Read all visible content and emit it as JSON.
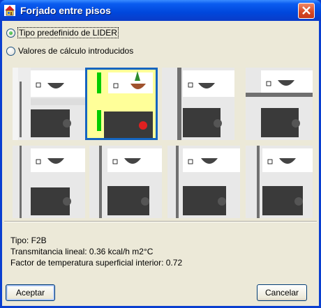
{
  "window": {
    "title": "Forjado entre pisos",
    "icon": "house-app-icon",
    "close_icon": "close-icon"
  },
  "options": {
    "predefined_label": "Tipo predefinido de LIDER",
    "predefined_selected": true,
    "custom_label": "Valores de cálculo introducidos",
    "custom_selected": false
  },
  "thumbnails": {
    "count": 8,
    "selected_index": 1,
    "highlight_color": "#ffff99",
    "insulation_color": "#00cc00",
    "lamp_color_selected": "#e02020"
  },
  "info": {
    "tipo": "Tipo: F2B",
    "transmitancia": "Transmitancia lineal: 0.36 kcal/h m2°C",
    "factor": "Factor de temperatura superficial interior: 0.72"
  },
  "buttons": {
    "accept": "Aceptar",
    "cancel": "Cancelar"
  }
}
